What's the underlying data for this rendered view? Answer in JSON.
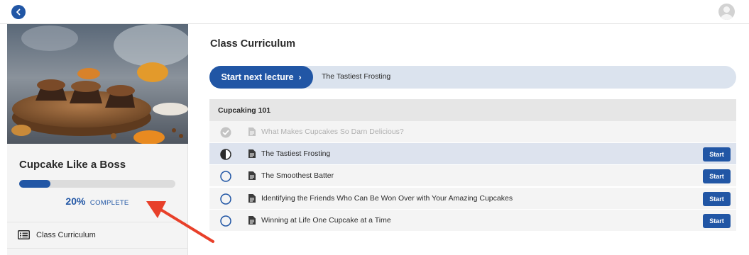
{
  "topbar": {
    "back_icon": "chevron-left-icon",
    "avatar_icon": "user-avatar-icon"
  },
  "sidebar": {
    "course_title": "Cupcake Like a Boss",
    "progress": {
      "percent": 20,
      "percent_label": "20%",
      "complete_label": "COMPLETE"
    },
    "nav_items": [
      {
        "label": "Class Curriculum",
        "icon": "curriculum-list-icon"
      }
    ]
  },
  "main": {
    "title": "Class Curriculum",
    "start_next": {
      "button_label": "Start next lecture",
      "lecture_title": "The Tastiest Frosting"
    },
    "sections": [
      {
        "title": "Cupcaking 101",
        "lectures": [
          {
            "title": "What Makes Cupcakes So Darn Delicious?",
            "status": "completed",
            "start_label": ""
          },
          {
            "title": "The Tastiest Frosting",
            "status": "in-progress",
            "start_label": "Start"
          },
          {
            "title": "The Smoothest Batter",
            "status": "not-started",
            "start_label": "Start"
          },
          {
            "title": "Identifying the Friends Who Can Be Won Over with Your Amazing Cupcakes",
            "status": "not-started",
            "start_label": "Start"
          },
          {
            "title": "Winning at Life One Cupcake at a Time",
            "status": "not-started",
            "start_label": "Start"
          }
        ]
      }
    ]
  },
  "colors": {
    "accent": "#2156a5",
    "annotation_arrow": "#e8402a"
  }
}
